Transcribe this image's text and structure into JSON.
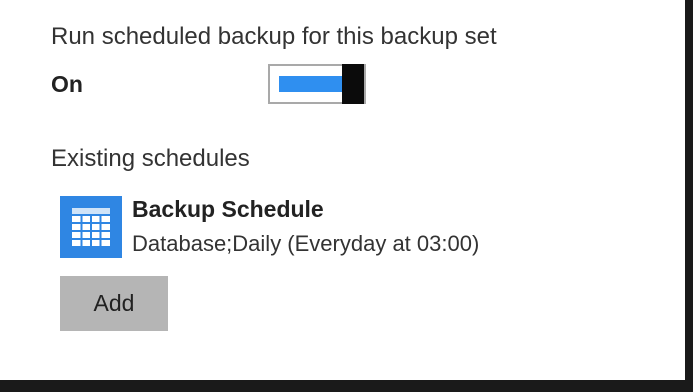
{
  "schedule_settings": {
    "run_label": "Run scheduled backup for this backup set",
    "status": "On",
    "toggle_enabled": true,
    "accent_color": "#2f8ff0"
  },
  "existing_schedules": {
    "heading": "Existing schedules",
    "items": [
      {
        "icon": "calendar-icon",
        "name": "Backup Schedule",
        "detail": "Database;Daily (Everyday at 03:00)"
      }
    ],
    "add_label": "Add"
  }
}
